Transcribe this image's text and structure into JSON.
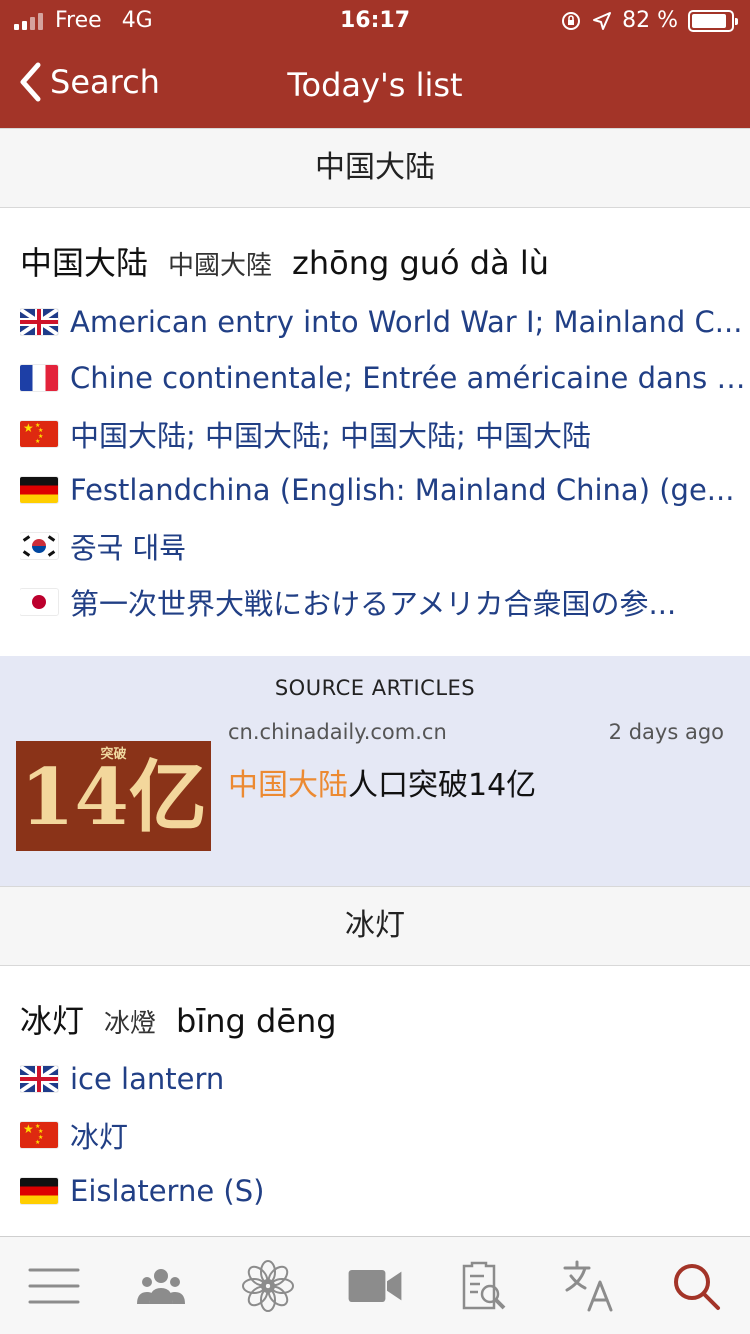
{
  "status": {
    "carrier": "Free",
    "network": "4G",
    "time": "16:17",
    "battery": "82 %"
  },
  "nav": {
    "back_label": "Search",
    "title": "Today's list"
  },
  "sections": [
    {
      "header": "中国大陆",
      "simplified": "中国大陆",
      "traditional": "中國大陸",
      "pinyin": "zhōng guó dà lù",
      "translations": [
        {
          "flag": "uk-flag",
          "text": "American entry into World War I; Mainland C..."
        },
        {
          "flag": "fr-flag",
          "text": "Chine continentale; Entrée américaine dans l..."
        },
        {
          "flag": "cn-flag",
          "text": "中国大陆; 中国大陆; 中国大陆; 中国大陆"
        },
        {
          "flag": "de-flag",
          "text": "Festlandchina (English: Mainland China) (ge..."
        },
        {
          "flag": "kr-flag",
          "text": "중국 대륙"
        },
        {
          "flag": "jp-flag",
          "text": "第一次世界大戦におけるアメリカ合衆国の参..."
        }
      ]
    },
    {
      "header": "冰灯",
      "simplified": "冰灯",
      "traditional": "冰燈",
      "pinyin": "bīng dēng",
      "translations": [
        {
          "flag": "uk-flag",
          "text": "ice lantern"
        },
        {
          "flag": "cn-flag",
          "text": "冰灯"
        },
        {
          "flag": "de-flag",
          "text": "Eislaterne (S)"
        }
      ]
    }
  ],
  "source_articles": {
    "label": "SOURCE ARTICLES",
    "domain": "cn.chinadaily.com.cn",
    "time": "2 days ago",
    "headline_highlight": "中国大陆",
    "headline_rest": "人口突破14亿",
    "thumb_small_text": "突破",
    "thumb_big_text": "14亿"
  },
  "tabs": [
    {
      "icon": "menu-icon"
    },
    {
      "icon": "people-icon"
    },
    {
      "icon": "flower-icon"
    },
    {
      "icon": "video-icon"
    },
    {
      "icon": "document-search-icon"
    },
    {
      "icon": "translate-icon"
    },
    {
      "icon": "search-icon",
      "active": true
    }
  ],
  "colors": {
    "header_bg": "#a33428",
    "link": "#213f85",
    "highlight": "#ec8a32",
    "source_bg": "#e5e8f5",
    "active_tab": "#a33428",
    "inactive_tab": "#8c8c8c"
  }
}
